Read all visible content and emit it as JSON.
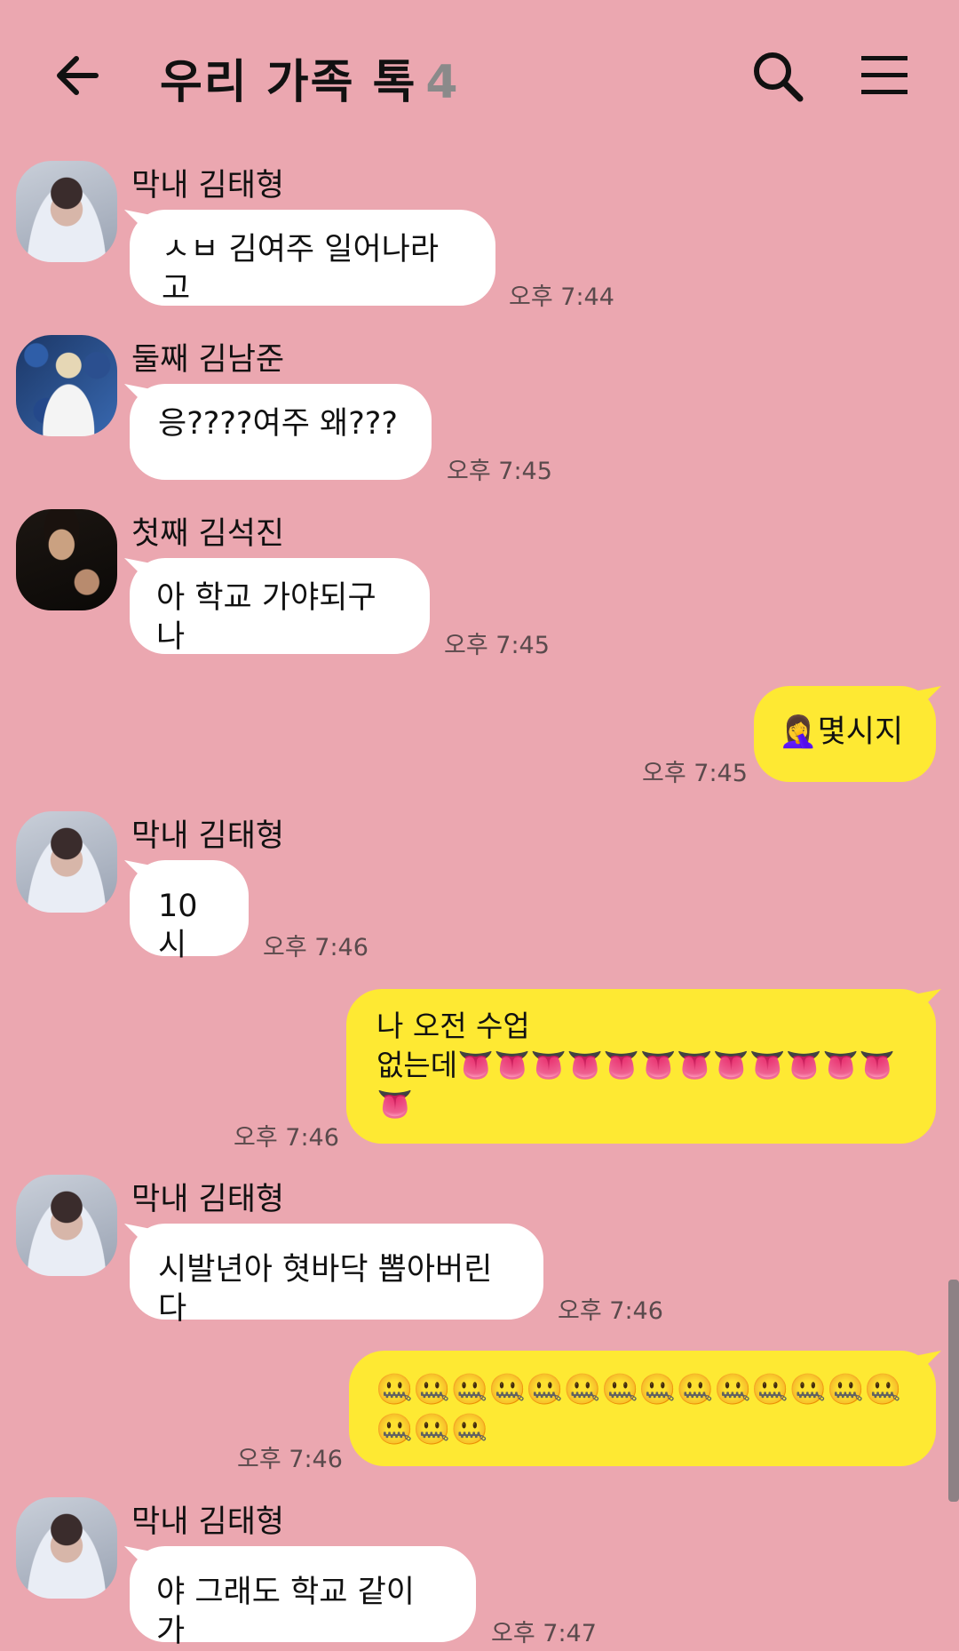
{
  "header": {
    "title": "우리 가족 톡",
    "member_count": "4",
    "icons": {
      "back": "arrow-left-icon",
      "search": "search-icon",
      "menu": "hamburger-menu-icon"
    }
  },
  "colors": {
    "background": "#eba7b0",
    "incoming_bubble": "#ffffff",
    "outgoing_bubble": "#fee933"
  },
  "messages": [
    {
      "sender": "막내 김태형",
      "text": "ㅅㅂ 김여주 일어나라고",
      "time": "오후 7:44",
      "direction": "in"
    },
    {
      "sender": "둘째 김남준",
      "text": "응????여주 왜???",
      "time": "오후 7:45",
      "direction": "in"
    },
    {
      "sender": "첫째 김석진",
      "text": "아 학교 가야되구나",
      "time": "오후 7:45",
      "direction": "in"
    },
    {
      "text": "🤦‍♀️몇시지",
      "time": "오후 7:45",
      "direction": "out"
    },
    {
      "sender": "막내 김태형",
      "text": "10시",
      "time": "오후 7:46",
      "direction": "in"
    },
    {
      "text": "나 오전 수업\n없는데👅👅👅👅👅👅👅👅👅👅👅👅👅",
      "time": "오후 7:46",
      "direction": "out"
    },
    {
      "sender": "막내 김태형",
      "text": "시발년아 혓바닥 뽑아버린다",
      "time": "오후 7:46",
      "direction": "in"
    },
    {
      "text": "🤐🤐🤐🤐🤐🤐🤐🤐🤐🤐🤐🤐🤐🤐🤐🤐🤐",
      "time": "오후 7:46",
      "direction": "out"
    },
    {
      "sender": "막내 김태형",
      "text": "야 그래도 학교 같이 가",
      "time": "오후 7:47",
      "direction": "in"
    }
  ]
}
